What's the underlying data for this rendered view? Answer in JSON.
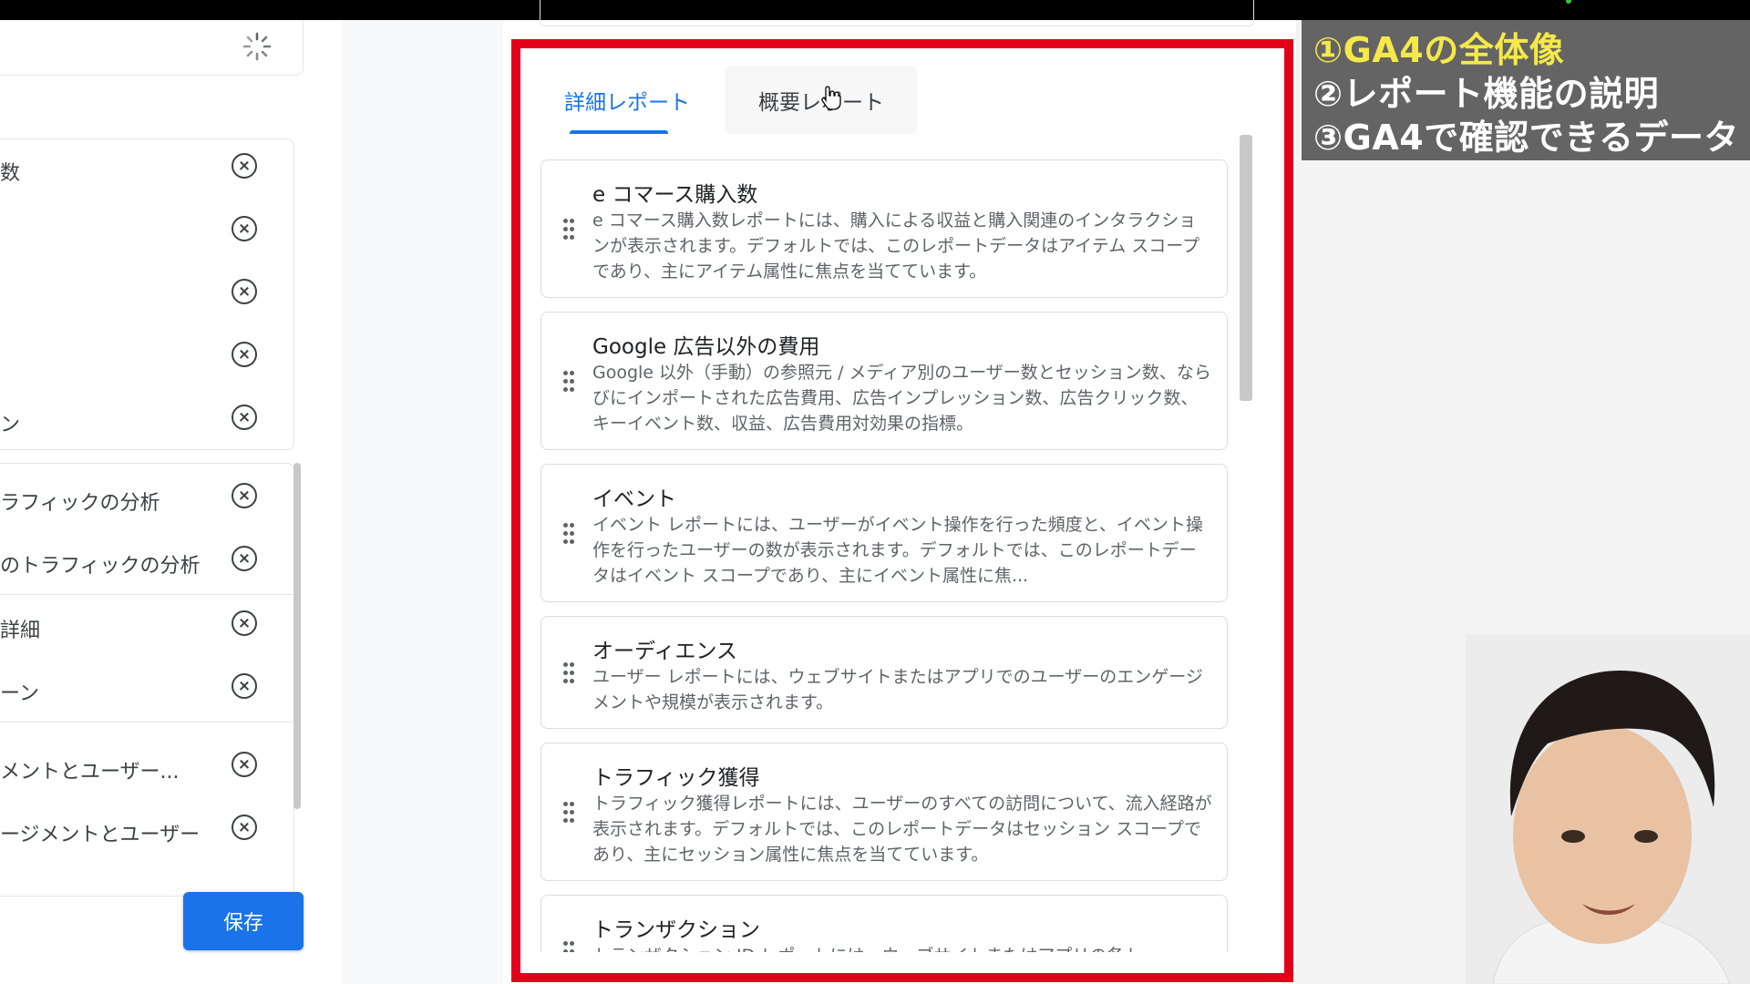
{
  "left_panel": {
    "items": [
      {
        "label": "数"
      },
      {
        "label": ""
      },
      {
        "label": ""
      },
      {
        "label": ""
      },
      {
        "label": "ン"
      },
      {
        "label": "ラフィックの分析"
      },
      {
        "label": "のトラフィックの分析"
      },
      {
        "label": "詳細"
      },
      {
        "label": "ーン"
      },
      {
        "label": "メントとユーザー..."
      },
      {
        "label": "ージメントとユーザー"
      }
    ],
    "save_label": "保存"
  },
  "tabs": [
    {
      "label": "詳細レポート",
      "active": true
    },
    {
      "label": "概要レポート",
      "active": false
    }
  ],
  "reports": [
    {
      "title": "e コマース購入数",
      "description": "e コマース購入数レポートには、購入による収益と購入関連のインタラクションが表示されます。デフォルトでは、このレポートデータはアイテム スコープであり、主にアイテム属性に焦点を当てています。"
    },
    {
      "title": "Google 広告以外の費用",
      "description": "Google 以外（手動）の参照元 / メディア別のユーザー数とセッション数、ならびにインポートされた広告費用、広告インプレッション数、広告クリック数、キーイベント数、収益、広告費用対効果の指標。"
    },
    {
      "title": "イベント",
      "description": "イベント レポートには、ユーザーがイベント操作を行った頻度と、イベント操作を行ったユーザーの数が表示されます。デフォルトでは、このレポートデータはイベント スコープであり、主にイベント属性に焦..."
    },
    {
      "title": "オーディエンス",
      "description": "ユーザー レポートには、ウェブサイトまたはアプリでのユーザーのエンゲージメントや規模が表示されます。"
    },
    {
      "title": "トラフィック獲得",
      "description": "トラフィック獲得レポートには、ユーザーのすべての訪問について、流入経路が表示されます。デフォルトでは、このレポートデータはセッション スコープであり、主にセッション属性に焦点を当てています。"
    },
    {
      "title": "トランザクション",
      "description": "トランザクション ID レポートには、ウェブサイトまたはアプリの各ト"
    }
  ],
  "overlay_lines": [
    {
      "text": "①GA4の全体像",
      "color": "#f5e94a"
    },
    {
      "text": "②レポート機能の説明",
      "color": "#ffffff"
    },
    {
      "text": "③GA4で確認できるデータ",
      "color": "#ffffff"
    }
  ],
  "colors": {
    "accent": "#1a73e8",
    "highlight_border": "#e3001b",
    "overlay_bg": "#646464"
  }
}
